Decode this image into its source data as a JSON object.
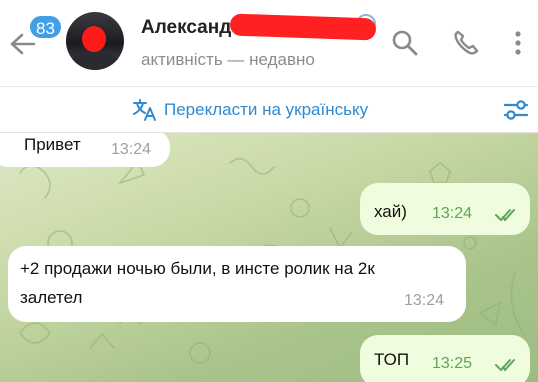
{
  "header": {
    "unread_count": "83",
    "contact_name": "Александ",
    "status": "активність — недавно",
    "icons": [
      "back-arrow-icon",
      "search-icon",
      "phone-icon",
      "more-vertical-icon"
    ]
  },
  "translate_bar": {
    "label": "Перекласти на українську",
    "icons": [
      "translate-icon",
      "settings-sliders-icon"
    ]
  },
  "colors": {
    "accent": "#3fa0e6",
    "link": "#2f8ad0",
    "outgoing_bubble": "#effdde",
    "outgoing_time": "#5fa55a",
    "incoming_time": "#a0a0a0"
  },
  "messages": [
    {
      "direction": "in",
      "text": "Привет",
      "time": "13:24"
    },
    {
      "direction": "out",
      "text": "хай)",
      "time": "13:24",
      "read": true
    },
    {
      "direction": "in",
      "text_line1": "+2 продажи ночью были, в инсте ролик на 2к",
      "text_line2": "залетел",
      "time": "13:24"
    },
    {
      "direction": "out",
      "text": "ТОП",
      "time": "13:25",
      "read": true
    }
  ]
}
